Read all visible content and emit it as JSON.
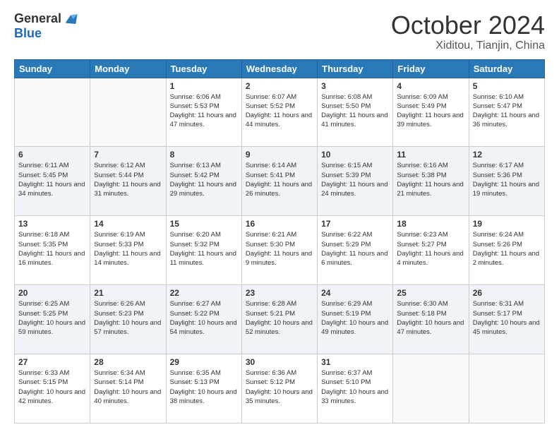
{
  "header": {
    "logo_general": "General",
    "logo_blue": "Blue",
    "month_title": "October 2024",
    "location": "Xiditou, Tianjin, China"
  },
  "days_of_week": [
    "Sunday",
    "Monday",
    "Tuesday",
    "Wednesday",
    "Thursday",
    "Friday",
    "Saturday"
  ],
  "weeks": [
    [
      {
        "day": "",
        "info": ""
      },
      {
        "day": "",
        "info": ""
      },
      {
        "day": "1",
        "info": "Sunrise: 6:06 AM\nSunset: 5:53 PM\nDaylight: 11 hours and 47 minutes."
      },
      {
        "day": "2",
        "info": "Sunrise: 6:07 AM\nSunset: 5:52 PM\nDaylight: 11 hours and 44 minutes."
      },
      {
        "day": "3",
        "info": "Sunrise: 6:08 AM\nSunset: 5:50 PM\nDaylight: 11 hours and 41 minutes."
      },
      {
        "day": "4",
        "info": "Sunrise: 6:09 AM\nSunset: 5:49 PM\nDaylight: 11 hours and 39 minutes."
      },
      {
        "day": "5",
        "info": "Sunrise: 6:10 AM\nSunset: 5:47 PM\nDaylight: 11 hours and 36 minutes."
      }
    ],
    [
      {
        "day": "6",
        "info": "Sunrise: 6:11 AM\nSunset: 5:45 PM\nDaylight: 11 hours and 34 minutes."
      },
      {
        "day": "7",
        "info": "Sunrise: 6:12 AM\nSunset: 5:44 PM\nDaylight: 11 hours and 31 minutes."
      },
      {
        "day": "8",
        "info": "Sunrise: 6:13 AM\nSunset: 5:42 PM\nDaylight: 11 hours and 29 minutes."
      },
      {
        "day": "9",
        "info": "Sunrise: 6:14 AM\nSunset: 5:41 PM\nDaylight: 11 hours and 26 minutes."
      },
      {
        "day": "10",
        "info": "Sunrise: 6:15 AM\nSunset: 5:39 PM\nDaylight: 11 hours and 24 minutes."
      },
      {
        "day": "11",
        "info": "Sunrise: 6:16 AM\nSunset: 5:38 PM\nDaylight: 11 hours and 21 minutes."
      },
      {
        "day": "12",
        "info": "Sunrise: 6:17 AM\nSunset: 5:36 PM\nDaylight: 11 hours and 19 minutes."
      }
    ],
    [
      {
        "day": "13",
        "info": "Sunrise: 6:18 AM\nSunset: 5:35 PM\nDaylight: 11 hours and 16 minutes."
      },
      {
        "day": "14",
        "info": "Sunrise: 6:19 AM\nSunset: 5:33 PM\nDaylight: 11 hours and 14 minutes."
      },
      {
        "day": "15",
        "info": "Sunrise: 6:20 AM\nSunset: 5:32 PM\nDaylight: 11 hours and 11 minutes."
      },
      {
        "day": "16",
        "info": "Sunrise: 6:21 AM\nSunset: 5:30 PM\nDaylight: 11 hours and 9 minutes."
      },
      {
        "day": "17",
        "info": "Sunrise: 6:22 AM\nSunset: 5:29 PM\nDaylight: 11 hours and 6 minutes."
      },
      {
        "day": "18",
        "info": "Sunrise: 6:23 AM\nSunset: 5:27 PM\nDaylight: 11 hours and 4 minutes."
      },
      {
        "day": "19",
        "info": "Sunrise: 6:24 AM\nSunset: 5:26 PM\nDaylight: 11 hours and 2 minutes."
      }
    ],
    [
      {
        "day": "20",
        "info": "Sunrise: 6:25 AM\nSunset: 5:25 PM\nDaylight: 10 hours and 59 minutes."
      },
      {
        "day": "21",
        "info": "Sunrise: 6:26 AM\nSunset: 5:23 PM\nDaylight: 10 hours and 57 minutes."
      },
      {
        "day": "22",
        "info": "Sunrise: 6:27 AM\nSunset: 5:22 PM\nDaylight: 10 hours and 54 minutes."
      },
      {
        "day": "23",
        "info": "Sunrise: 6:28 AM\nSunset: 5:21 PM\nDaylight: 10 hours and 52 minutes."
      },
      {
        "day": "24",
        "info": "Sunrise: 6:29 AM\nSunset: 5:19 PM\nDaylight: 10 hours and 49 minutes."
      },
      {
        "day": "25",
        "info": "Sunrise: 6:30 AM\nSunset: 5:18 PM\nDaylight: 10 hours and 47 minutes."
      },
      {
        "day": "26",
        "info": "Sunrise: 6:31 AM\nSunset: 5:17 PM\nDaylight: 10 hours and 45 minutes."
      }
    ],
    [
      {
        "day": "27",
        "info": "Sunrise: 6:33 AM\nSunset: 5:15 PM\nDaylight: 10 hours and 42 minutes."
      },
      {
        "day": "28",
        "info": "Sunrise: 6:34 AM\nSunset: 5:14 PM\nDaylight: 10 hours and 40 minutes."
      },
      {
        "day": "29",
        "info": "Sunrise: 6:35 AM\nSunset: 5:13 PM\nDaylight: 10 hours and 38 minutes."
      },
      {
        "day": "30",
        "info": "Sunrise: 6:36 AM\nSunset: 5:12 PM\nDaylight: 10 hours and 35 minutes."
      },
      {
        "day": "31",
        "info": "Sunrise: 6:37 AM\nSunset: 5:10 PM\nDaylight: 10 hours and 33 minutes."
      },
      {
        "day": "",
        "info": ""
      },
      {
        "day": "",
        "info": ""
      }
    ]
  ]
}
